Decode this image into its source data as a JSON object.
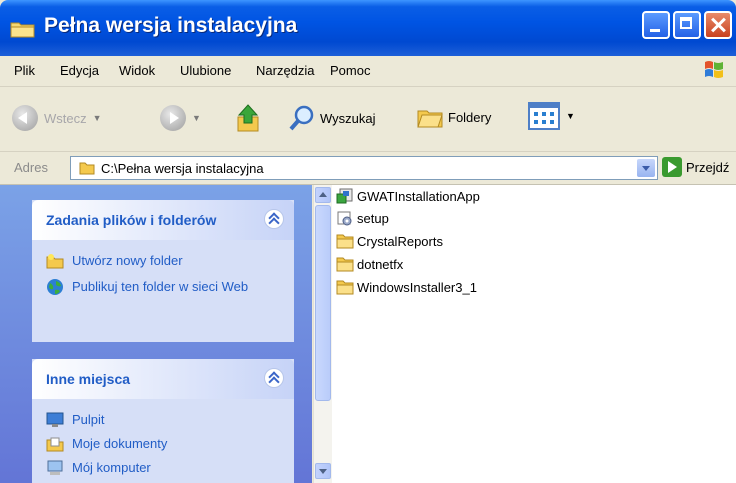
{
  "window": {
    "title": "Pełna wersja instalacyjna"
  },
  "menu": [
    "Plik",
    "Edycja",
    "Widok",
    "Ulubione",
    "Narzędzia",
    "Pomoc"
  ],
  "toolbar": {
    "back_label": "Wstecz",
    "search_label": "Wyszukaj",
    "folders_label": "Foldery"
  },
  "address": {
    "label": "Adres",
    "path": "C:\\Pełna wersja instalacyjna",
    "go_label": "Przejdź"
  },
  "file_tasks": {
    "title": "Zadania plików i folderów",
    "items": [
      "Utwórz nowy folder",
      "Publikuj ten folder w sieci Web"
    ]
  },
  "other_places": {
    "title": "Inne miejsca",
    "items": [
      "Pulpit",
      "Moje dokumenty",
      "Mój komputer"
    ]
  },
  "files": [
    {
      "name": "GWATInstallationApp",
      "icon": "installer-app-icon"
    },
    {
      "name": "setup",
      "icon": "setup-icon"
    },
    {
      "name": "CrystalReports",
      "icon": "folder-icon"
    },
    {
      "name": "dotnetfx",
      "icon": "folder-icon"
    },
    {
      "name": "WindowsInstaller3_1",
      "icon": "folder-icon"
    }
  ],
  "colors": {
    "titlebar": "#0054e3",
    "taskpane": "#6f8fdf",
    "panel_title": "#215dc6"
  }
}
